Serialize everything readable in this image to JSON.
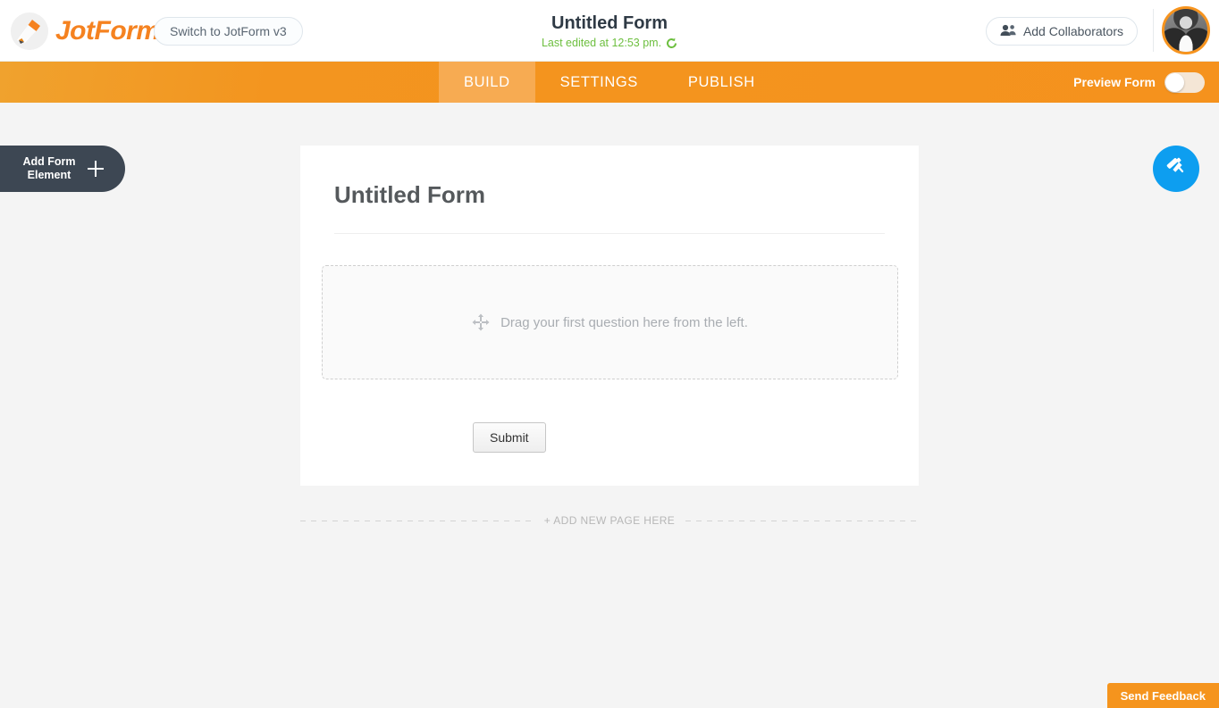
{
  "colors": {
    "brand_orange": "#f58220",
    "nav_orange": "#f5921d",
    "active_tab_orange": "#f7ab52",
    "green": "#6dbf3f",
    "designer_blue": "#0d9ef0",
    "dark_slate": "#3d4753",
    "page_background": "#f4f4f4"
  },
  "header": {
    "logo_icon": "pencil-logo-icon",
    "wordmark": "JotForm",
    "switch_version_label": "Switch to JotForm v3",
    "form_title": "Untitled Form",
    "last_edited": "Last edited at 12:53 pm.",
    "refresh_icon": "refresh-icon",
    "collaborators_label": "Add Collaborators",
    "collaborators_icon": "people-icon",
    "avatar": "user-avatar"
  },
  "navbar": {
    "tabs": [
      {
        "label": "BUILD",
        "active": true
      },
      {
        "label": "SETTINGS",
        "active": false
      },
      {
        "label": "PUBLISH",
        "active": false
      }
    ],
    "preview_label": "Preview Form",
    "preview_enabled": false
  },
  "left_panel": {
    "add_element_line1": "Add Form",
    "add_element_line2": "Element",
    "plus_icon": "plus-icon"
  },
  "form": {
    "heading": "Untitled Form",
    "dropzone_icon": "move-arrows-icon",
    "dropzone_text": "Drag your first question here from the left.",
    "submit_label": "Submit"
  },
  "add_page": {
    "label": "+ ADD NEW PAGE HERE"
  },
  "designer": {
    "icon": "paint-roller-icon"
  },
  "feedback": {
    "label": "Send Feedback"
  }
}
